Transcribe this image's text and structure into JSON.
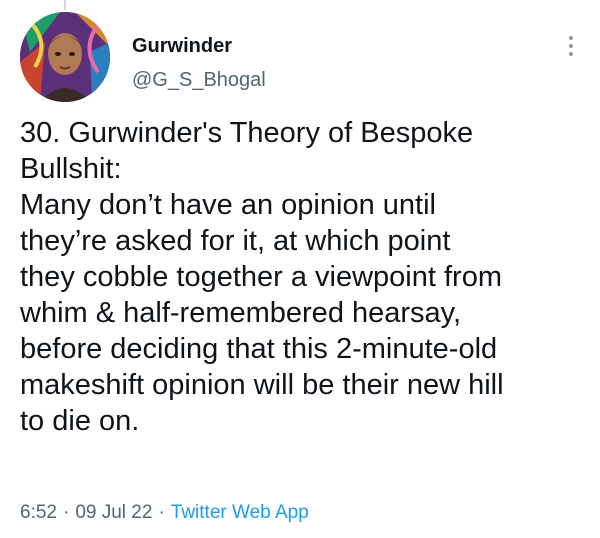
{
  "author": {
    "name": "Gurwinder",
    "handle": "@G_S_Bhogal"
  },
  "menu_icon": "more-vertical-icon",
  "tweet": {
    "lines": [
      "30. Gurwinder's Theory of Bespoke",
      "Bullshit:",
      "Many don’t have an opinion until",
      "they’re asked for it, at which point",
      "they cobble together a viewpoint from",
      "whim & half-remembered hearsay,",
      "before deciding that this 2-minute-old",
      "makeshift opinion will be their new hill",
      "to die on."
    ]
  },
  "meta": {
    "time": "6:52",
    "separator": "·",
    "date": "09 Jul 22",
    "source": "Twitter Web App"
  },
  "colors": {
    "text": "#0f1419",
    "secondary": "#536471",
    "link": "#1d9bf0"
  }
}
